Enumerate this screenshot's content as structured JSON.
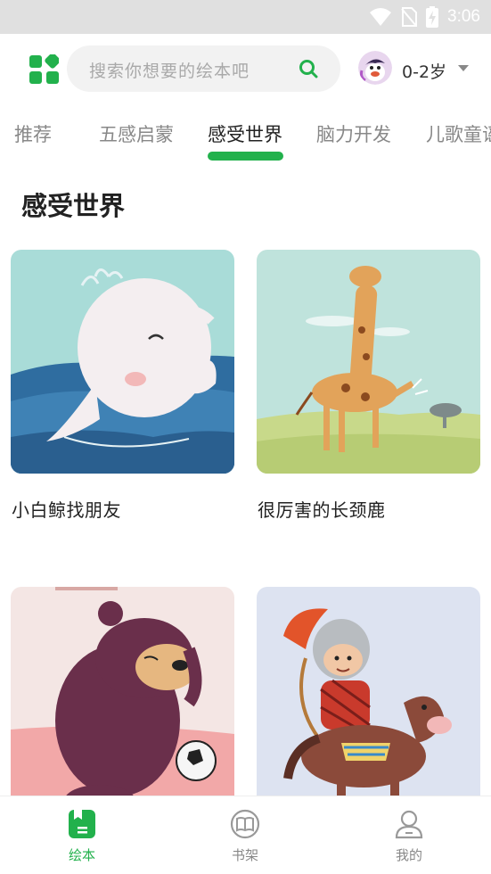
{
  "status_bar": {
    "time": "3:06",
    "icons": [
      "wifi-icon",
      "no-sim-icon",
      "battery-charging-icon"
    ]
  },
  "header": {
    "logo_icon": "apps-grid-icon",
    "search": {
      "placeholder": "搜索你想要的绘本吧",
      "icon": "search-icon"
    },
    "age_selector": {
      "value": "0-2岁",
      "icon": "caret-down-icon"
    }
  },
  "tabs": [
    {
      "label": "推荐"
    },
    {
      "label": "五感启蒙"
    },
    {
      "label": "感受世界",
      "active": true
    },
    {
      "label": "脑力开发"
    },
    {
      "label": "儿歌童谣"
    }
  ],
  "section": {
    "title": "感受世界"
  },
  "books": [
    {
      "title": "小白鲸找朋友"
    },
    {
      "title": "很厉害的长颈鹿"
    },
    {
      "title": ""
    },
    {
      "title": ""
    }
  ],
  "bottom_nav": [
    {
      "label": "绘本",
      "icon": "picture-book-icon",
      "active": true
    },
    {
      "label": "书架",
      "icon": "bookshelf-icon"
    },
    {
      "label": "我的",
      "icon": "profile-icon"
    }
  ],
  "colors": {
    "accent": "#22b14c",
    "status_bar_bg": "#e0e0e0",
    "search_bg": "#f2f2f2"
  }
}
